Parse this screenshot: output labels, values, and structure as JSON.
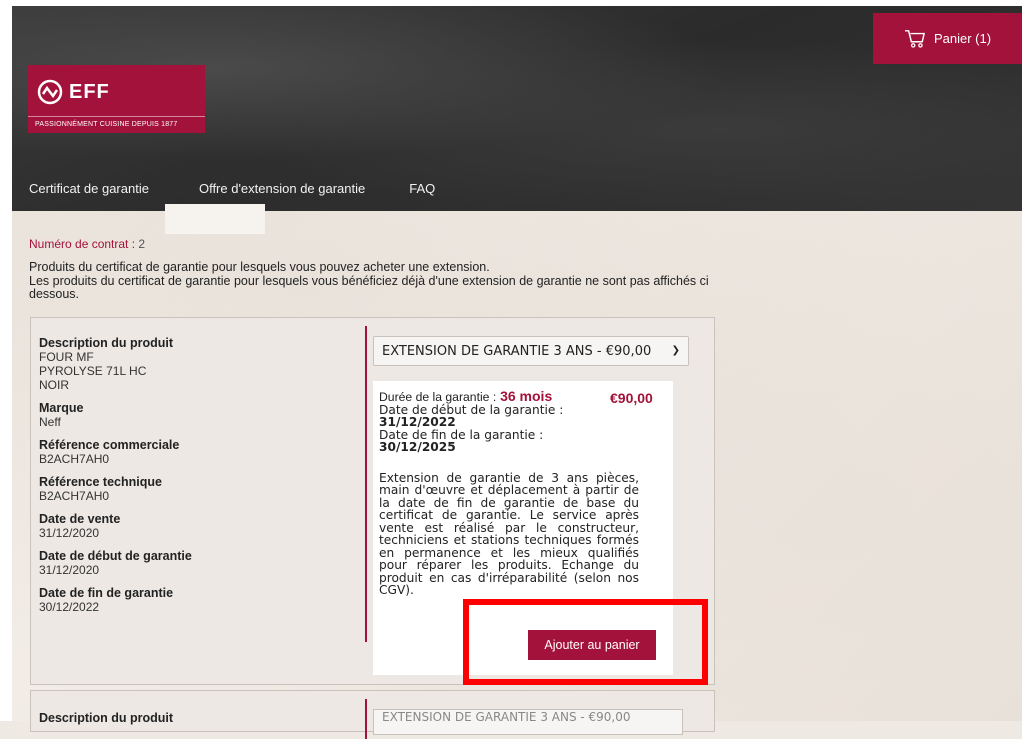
{
  "header": {
    "cart_label": "Panier (1)",
    "logo_brand": "EFF",
    "logo_tagline": "PASSIONNÉMENT CUISINE DEPUIS 1877"
  },
  "nav": {
    "items": [
      "Certificat de garantie",
      "Offre d'extension de garantie",
      "FAQ"
    ]
  },
  "contract": {
    "label": "Numéro de contrat :",
    "number": "2"
  },
  "intro": {
    "line1": "Produits du certificat de garantie pour lesquels vous pouvez acheter une extension.",
    "line2": "Les produits du certificat de garantie pour lesquels vous bénéficiez déjà d'une extension de garantie ne sont pas affichés ci dessous."
  },
  "product": {
    "description_label": "Description du produit",
    "description_value": "FOUR MF PYROLYSE 71L HC NOIR",
    "brand_label": "Marque",
    "brand_value": "Neff",
    "commercial_ref_label": "Référence commerciale",
    "commercial_ref_value": "B2ACH7AH0",
    "technical_ref_label": "Référence technique",
    "technical_ref_value": "B2ACH7AH0",
    "sale_date_label": "Date de vente",
    "sale_date_value": "31/12/2020",
    "warranty_start_label": "Date de début de garantie",
    "warranty_start_value": "31/12/2020",
    "warranty_end_label": "Date de fin de garantie",
    "warranty_end_value": "30/12/2022"
  },
  "offer": {
    "selected_option": "EXTENSION DE GARANTIE 3 ANS - €90,00",
    "duration_label": "Durée de la garantie :",
    "duration_value": "36 mois",
    "price": "€90,00",
    "start_label": "Date de début de la garantie :",
    "start_value": "31/12/2022",
    "end_label": "Date de fin de la garantie :",
    "end_value": "30/12/2025",
    "description": "Extension de garantie de 3 ans pièces, main d'œuvre et déplacement à partir de la date de fin de garantie de base du certificat de garantie. Le service après vente est réalisé par le constructeur, techniciens et stations techniques formés en permanence et les mieux qualifiés pour réparer les produits. Echange du produit en cas d'irréparabilité (selon nos CGV).",
    "add_button": "Ajouter au panier"
  },
  "product2": {
    "description_label": "Description du produit",
    "selected_option": "EXTENSION DE GARANTIE 3 ANS - €90,00"
  },
  "colors": {
    "brand": "#a3123a",
    "highlight": "#ff0000"
  }
}
